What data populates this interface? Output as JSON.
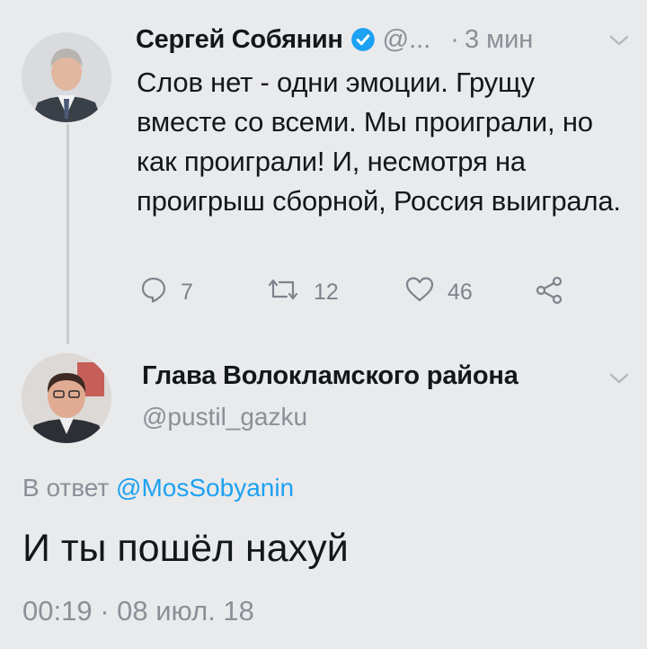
{
  "tweet1": {
    "name": "Сергей Собянин",
    "handle": "@...",
    "separator": "·",
    "time": "3 мин",
    "text": "Слов нет - одни эмоции. Грущу вместе со всеми. Мы проиграли, но как проиграли! И, несмотря на проигрыш сборной, Россия выиграла.",
    "actions": {
      "reply_count": "7",
      "retweet_count": "12",
      "like_count": "46"
    }
  },
  "tweet2": {
    "name": "Глава Волокламского района",
    "handle": "@pustil_gazku",
    "reply_prefix": "В ответ",
    "reply_mention": "@MosSobyanin",
    "text": "И ты пошёл нахуй",
    "timestamp": "00:19 · 08 июл. 18"
  },
  "colors": {
    "background": "#e9eaec",
    "accent": "#1da1f2",
    "muted": "#8a9098",
    "text": "#14171a"
  },
  "icons": [
    "verified-badge-icon",
    "chevron-down-icon",
    "reply-icon",
    "retweet-icon",
    "like-icon",
    "share-icon"
  ]
}
